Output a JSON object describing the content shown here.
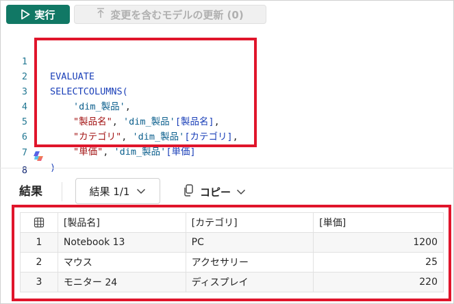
{
  "toolbar": {
    "run_label": "実行",
    "apply_label": "変更を含むモデルの更新 (0)"
  },
  "editor": {
    "line_numbers": [
      "1",
      "2",
      "3",
      "4",
      "5",
      "6",
      "7",
      "8"
    ],
    "l1_kw": "EVALUATE",
    "l2_kw": "SELECTCOLUMNS(",
    "l3_tbl": "'dim_製品'",
    "l3_comma": ",",
    "l4_name": "\"製品名\"",
    "l4_sep": ", ",
    "l4_tbl": "'dim_製品'",
    "l4_col": "[製品名]",
    "l4_comma": ",",
    "l5_name": "\"カテゴリ\"",
    "l5_sep": ", ",
    "l5_tbl": "'dim_製品'",
    "l5_col": "[カテゴリ]",
    "l5_comma": ",",
    "l6_name": "\"単価\"",
    "l6_sep": ", ",
    "l6_tbl": "'dim_製品'",
    "l6_col": "[単価]",
    "l7_close": ")"
  },
  "results": {
    "title": "結果",
    "selector_label": "結果 1/1",
    "copy_label": "コピー",
    "columns": [
      "[製品名]",
      "[カテゴリ]",
      "[単価]"
    ],
    "rows": [
      {
        "index": "1",
        "name": "Notebook 13",
        "category": "PC",
        "price": "1200"
      },
      {
        "index": "2",
        "name": "マウス",
        "category": "アクセサリー",
        "price": "25"
      },
      {
        "index": "3",
        "name": "モニター 24",
        "category": "ディスプレイ",
        "price": "220"
      }
    ]
  },
  "colors": {
    "run_button": "#117865",
    "highlight_box": "#e0152b",
    "keyword": "#1a3fb8",
    "string": "#a31515"
  }
}
